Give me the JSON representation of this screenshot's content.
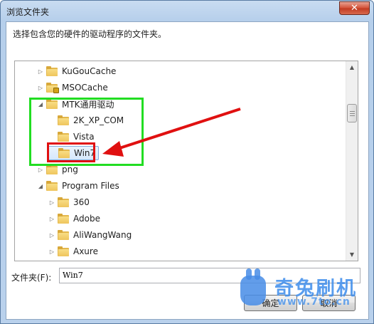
{
  "window": {
    "title": "浏览文件夹",
    "close_glyph": "✕"
  },
  "instruction": "选择包含您的硬件的驱动程序的文件夹。",
  "tree": {
    "items": [
      {
        "label": "KuGouCache",
        "expander": "▷",
        "icon": "folder-icon"
      },
      {
        "label": "MSOCache",
        "expander": "▷",
        "icon": "locked-folder-icon"
      },
      {
        "label": "MTK通用驱动",
        "expander": "◢",
        "icon": "folder-icon"
      },
      {
        "label": "2K_XP_COM",
        "expander": "",
        "icon": "folder-icon"
      },
      {
        "label": "Vista",
        "expander": "",
        "icon": "folder-icon"
      },
      {
        "label": "Win7",
        "expander": "",
        "icon": "folder-icon",
        "selected": true
      },
      {
        "label": "png",
        "expander": "▷",
        "icon": "folder-icon"
      },
      {
        "label": "Program Files",
        "expander": "◢",
        "icon": "folder-icon"
      },
      {
        "label": "360",
        "expander": "▷",
        "icon": "folder-icon"
      },
      {
        "label": "Adobe",
        "expander": "▷",
        "icon": "folder-icon"
      },
      {
        "label": "AliWangWang",
        "expander": "▷",
        "icon": "folder-icon"
      },
      {
        "label": "Axure",
        "expander": "▷",
        "icon": "folder-icon"
      }
    ],
    "scroll_up": "▲",
    "scroll_down": "▼"
  },
  "folder_field": {
    "label": "文件夹(F):",
    "value": "Win7"
  },
  "buttons": {
    "ok": "确定",
    "cancel": "取消"
  },
  "watermark": {
    "brand": "奇兔刷机",
    "url": "www.7to.cn"
  },
  "colors": {
    "highlight_green": "#22dd22",
    "highlight_red": "#e01010",
    "arrow_red": "#e01010",
    "titlebar": "#c9dcf1"
  }
}
